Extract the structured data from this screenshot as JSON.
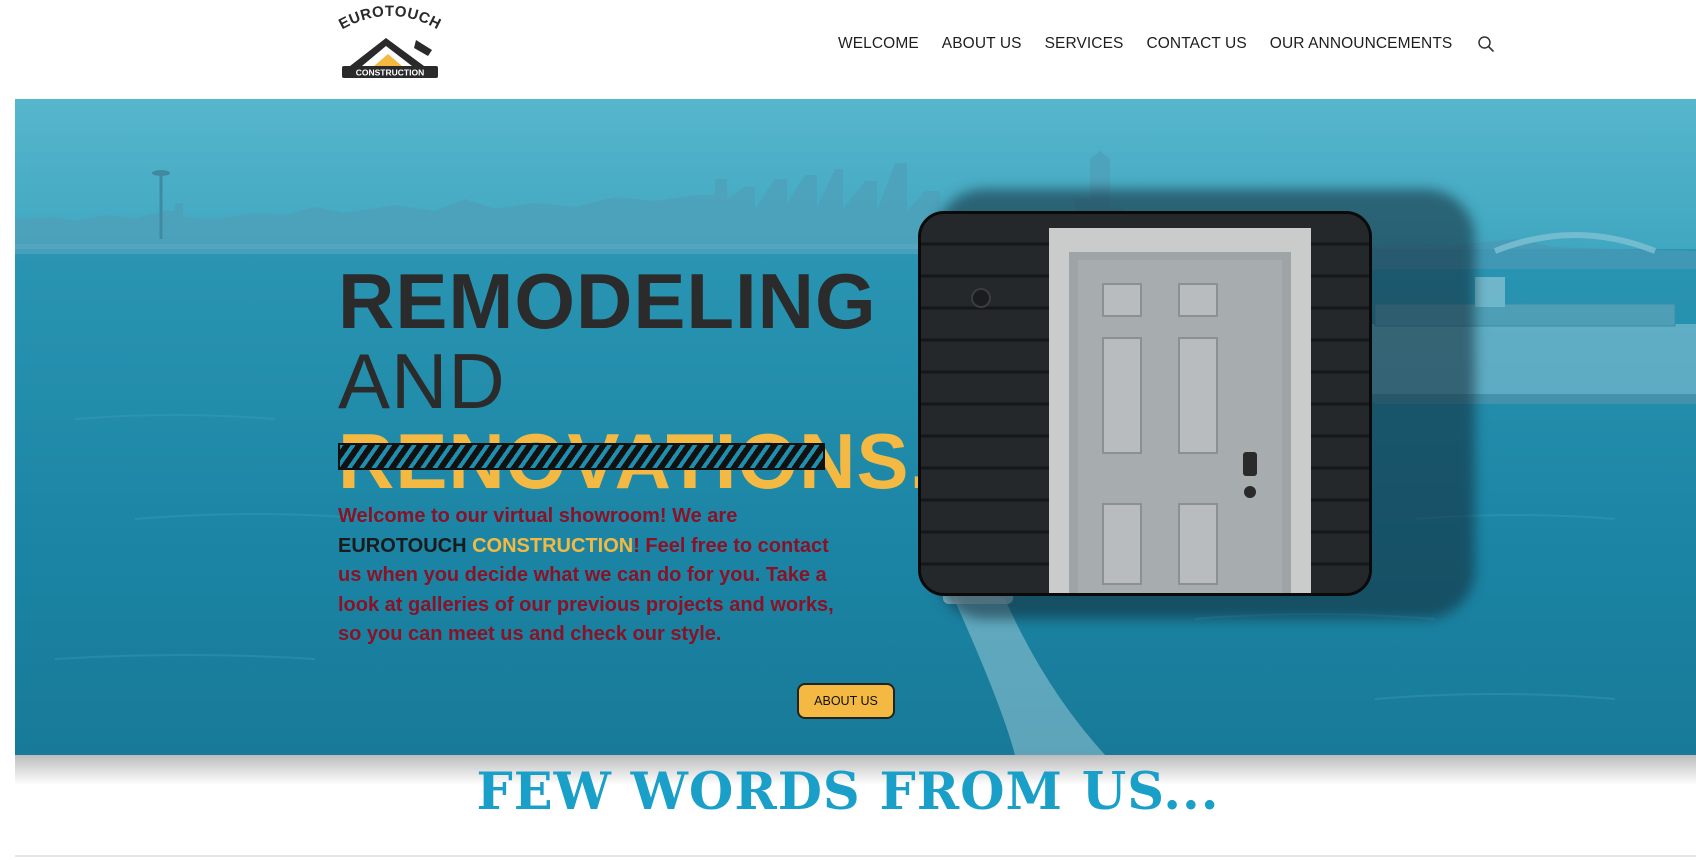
{
  "header": {
    "logo": {
      "text_top": "EUROTOUCH",
      "text_bottom": "CONSTRUCTION",
      "icon": "house-roof-logo"
    },
    "nav": [
      {
        "label": "WELCOME"
      },
      {
        "label": "ABOUT US"
      },
      {
        "label": "SERVICES"
      },
      {
        "label": "CONTACT US"
      },
      {
        "label": "OUR ANNOUNCEMENTS"
      }
    ],
    "search_icon": "search-icon"
  },
  "hero": {
    "headline_1": "REMODELING",
    "headline_2": "AND",
    "headline_3": "RENOVATIONS.",
    "intro_part1": "Welcome to our virtual showroom! We are ",
    "brand_part1": "EUROTOUCH",
    "brand_part2": "CONSTRUCTION",
    "intro_part2": "! Feel free to contact us when you decide what we can do for you. Take a look at galleries of our previous projects and works, so you can meet us and check our style.",
    "button_label": "ABOUT US",
    "image": "white-door-photo",
    "background": "city-harbor-photo"
  },
  "section": {
    "title": "FEW WORDS FROM US..."
  },
  "colors": {
    "accent_yellow": "#f4b942",
    "hero_blue": "#1f8fb0",
    "title_blue": "#1aa0c8",
    "intro_text": "#8a1226"
  }
}
